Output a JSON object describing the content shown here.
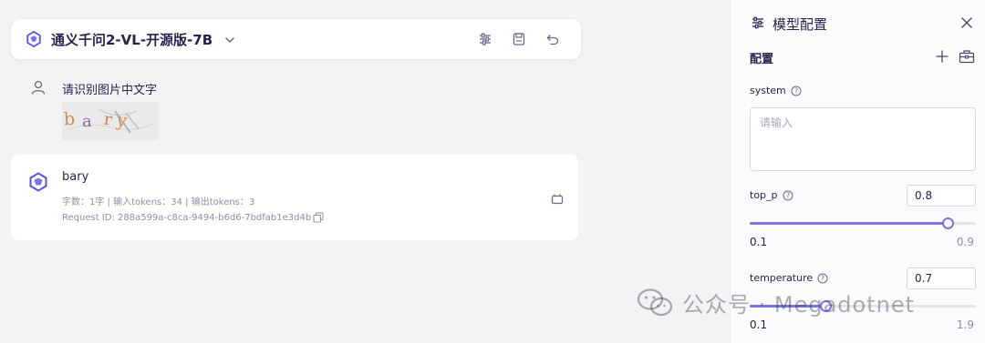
{
  "header": {
    "model_name": "通义千问2-VL-开源版-7B",
    "icons": [
      "sliders-icon",
      "save-icon",
      "undo-icon"
    ]
  },
  "conversation": {
    "user_message": "请识别图片中文字",
    "captcha_letters": [
      "b",
      "a",
      "r",
      "y"
    ],
    "reply": {
      "text": "bary",
      "meta": "字数：1字 | 输入tokens：34 | 输出tokens：3",
      "request_id": "Request ID: 288a599a-c8ca-9494-b6d6-7bdfab1e3d4b"
    }
  },
  "watermark": {
    "text": "公众号 · Megadotnet"
  },
  "config_panel": {
    "title": "模型配置",
    "section_label": "配置",
    "system": {
      "label": "system",
      "placeholder": "请输入",
      "value": ""
    },
    "top_p": {
      "label": "top_p",
      "value": "0.8",
      "min": "0.1",
      "max": "0.9",
      "fraction": 0.875
    },
    "temperature": {
      "label": "temperature",
      "value": "0.7",
      "min": "0.1",
      "max": "1.9",
      "fraction": 0.333
    }
  },
  "colors": {
    "accent": "#7b73e8",
    "background": "#f3f3f6",
    "panel": "#fbfbfd",
    "text": "#26244c",
    "muted": "#8f8da8"
  }
}
